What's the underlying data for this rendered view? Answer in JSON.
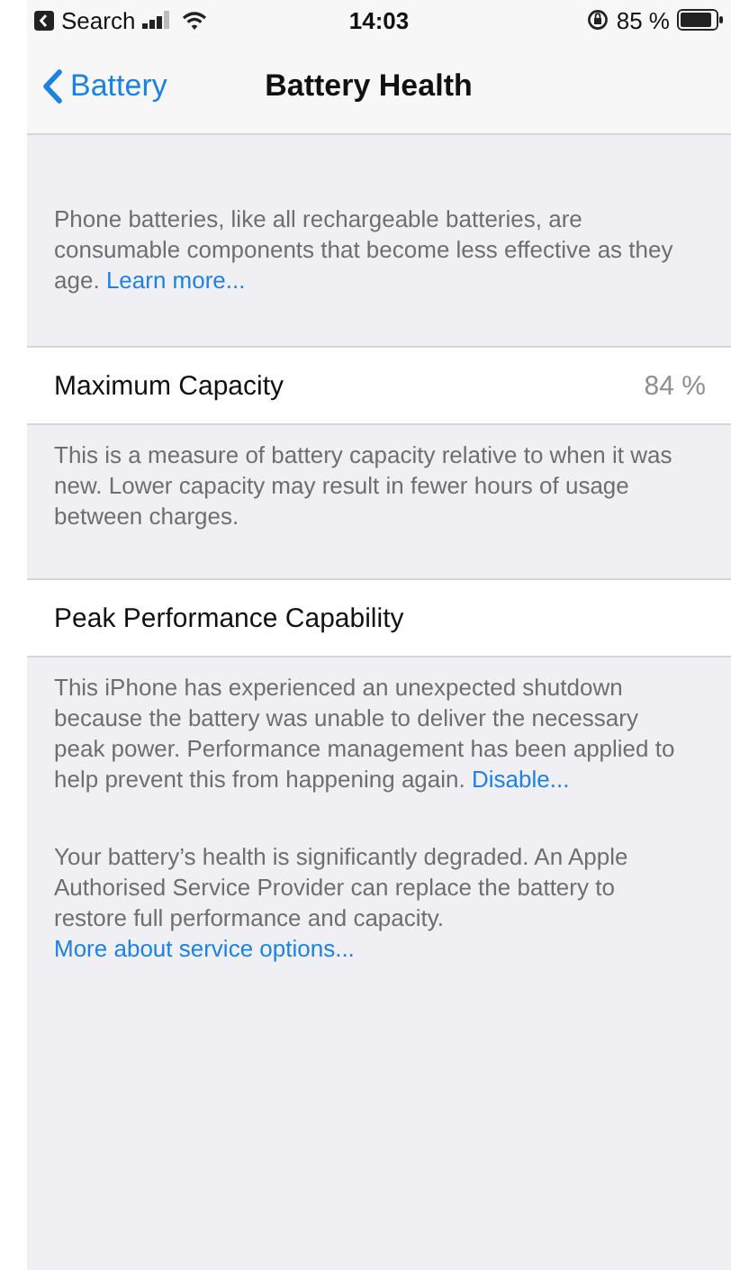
{
  "status_bar": {
    "back_app": "Search",
    "time": "14:03",
    "battery_percent": "85 %"
  },
  "nav": {
    "back": "Battery",
    "title": "Battery Health"
  },
  "sections": [
    {
      "kind": "note",
      "text": "Phone batteries, like all rechargeable batteries, are consumable components that become less effective as they age.",
      "link": "Learn more..."
    },
    {
      "kind": "row",
      "label": "Maximum Capacity",
      "value": "84 %",
      "footer": "This is a measure of battery capacity relative to when it was new. Lower capacity may result in fewer hours of usage between charges."
    },
    {
      "kind": "row",
      "label": "Peak Performance Capability",
      "footer": "This iPhone has experienced an unexpected shutdown because the battery was unable to deliver the necessary peak power. Performance management has been applied to help prevent this from happening again.",
      "footer_link": "Disable..."
    },
    {
      "kind": "note",
      "text": "Your battery’s health is significantly degraded. An Apple Authorised Service Provider can replace the battery to restore full performance and capacity.",
      "link": "More about service options...",
      "link_break": true
    }
  ]
}
